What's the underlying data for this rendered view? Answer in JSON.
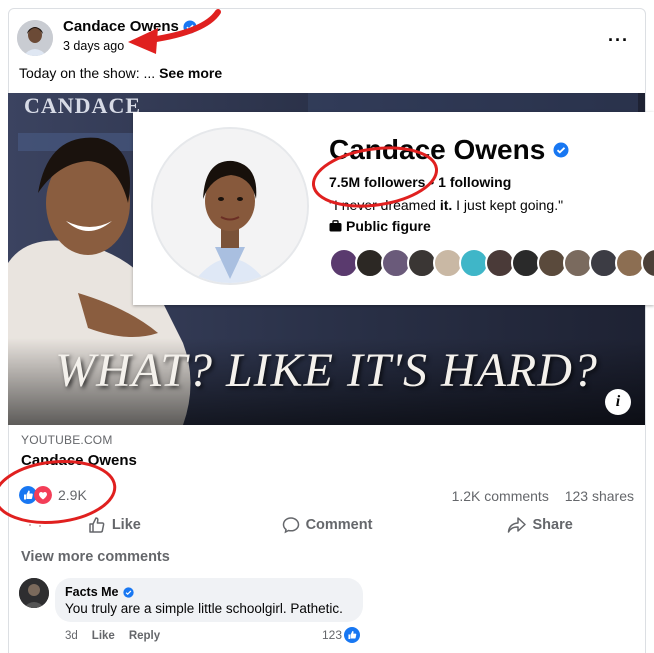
{
  "post": {
    "author": "Candace Owens",
    "time": "3 days ago",
    "caption": "Today on the show: ...",
    "see_more": "See more",
    "more_icon": "···"
  },
  "media": {
    "banner_text": "CANDACE",
    "headline": "WHAT? LIKE IT'S HARD?",
    "info_icon": "i"
  },
  "profile_card": {
    "name": "Candace Owens",
    "followers": "7.5M followers",
    "separator": " • ",
    "following": "1 following",
    "quote_start": "\"I never dreamed ",
    "quote_bold": "it.",
    "quote_end": " I just kept going.\"",
    "category": "Public figure"
  },
  "link": {
    "domain": "YOUTUBE.COM",
    "title": "Candace Owens"
  },
  "engagement": {
    "reactions": "2.9K",
    "comments": "1.2K comments",
    "shares": "123 shares"
  },
  "actions": {
    "like": "Like",
    "comment": "Comment",
    "share": "Share"
  },
  "comments_section": {
    "view_more": "View more comments",
    "comment": {
      "author": "Facts Me",
      "text": "You truly are a simple little schoolgirl. Pathetic.",
      "time": "3d",
      "like": "Like",
      "reply": "Reply",
      "reactions": "123"
    }
  },
  "colors": {
    "accent_blue": "#1877f2",
    "annotation_red": "#e0201f",
    "secondary_text": "#65676b"
  }
}
